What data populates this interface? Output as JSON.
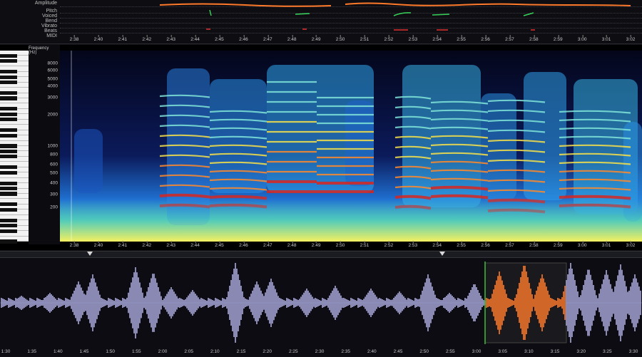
{
  "tracks": {
    "labels": [
      "Amplitude",
      "Pitch",
      "Voiced",
      "Bend",
      "Vibrato",
      "Beats",
      "MIDI"
    ]
  },
  "time_ruler": [
    "2:38",
    "2:40",
    "2:41",
    "2:42",
    "2:43",
    "2:44",
    "2:45",
    "2:46",
    "2:47",
    "2:48",
    "2:49",
    "2:50",
    "2:51",
    "2:52",
    "2:53",
    "2:54",
    "2:55",
    "2:56",
    "2:57",
    "2:58",
    "2:59",
    "3:00",
    "3:01",
    "3:02"
  ],
  "spectrogram": {
    "axis_title": "Frequency (Hz)",
    "freq_labels": [
      "8000",
      "6000",
      "5000",
      "4000",
      "3000",
      "2000",
      "1000",
      "800",
      "600",
      "500",
      "400",
      "300",
      "200"
    ]
  },
  "waveform": {
    "ruler": [
      "1:30",
      "1:35",
      "1:40",
      "1:45",
      "1:50",
      "1:55",
      "2:00",
      "2:05",
      "2:10",
      "2:15",
      "2:20",
      "2:25",
      "2:30",
      "2:35",
      "2:40",
      "2:45",
      "2:50",
      "2:55",
      "3:00",
      "3:05",
      "3:10",
      "3:15",
      "3:20",
      "3:25",
      "3:30"
    ],
    "colors": {
      "wave": "#a9a9dc",
      "selection": "#ff7a2a",
      "cursor": "#3cbf3c"
    }
  },
  "icons": {
    "scroll_marker": "triangle-down-icon"
  }
}
